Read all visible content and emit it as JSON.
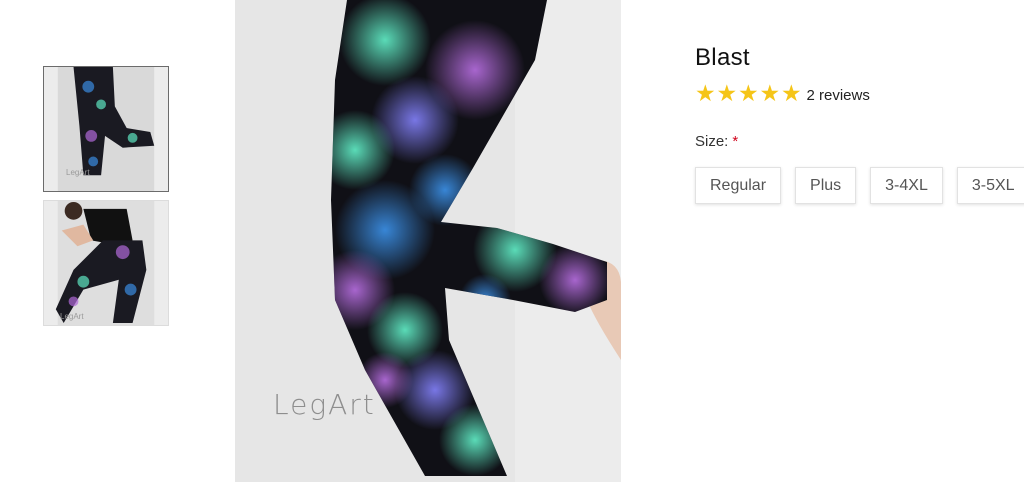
{
  "gallery": {
    "thumbnails": [
      {
        "label": "Blast leggings – side view",
        "watermark": "LegArt"
      },
      {
        "label": "Blast leggings – seated view",
        "watermark": "LegArt"
      }
    ],
    "main_watermark": "LegArt"
  },
  "product": {
    "title": "Blast",
    "rating": {
      "stars": 5,
      "max": 5,
      "reviews_text": "2 reviews"
    },
    "size": {
      "label": "Size:",
      "required_mark": "*",
      "options": [
        "Regular",
        "Plus",
        "3-4XL",
        "3-5XL"
      ]
    }
  },
  "colors": {
    "star": "#f5c518",
    "required": "#d0021b",
    "pattern": [
      "#5ee6c0",
      "#3a8ce0",
      "#b06ad8",
      "#7e7cf0"
    ]
  }
}
